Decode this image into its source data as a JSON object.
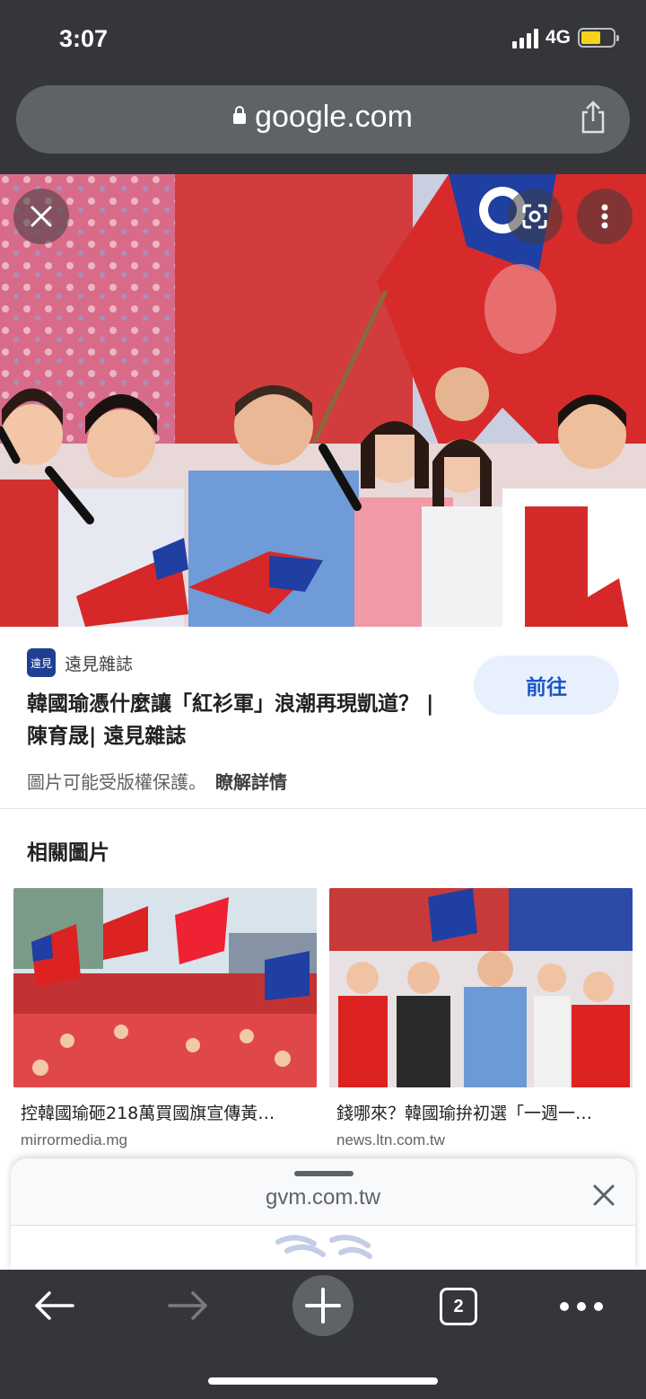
{
  "status_bar": {
    "time": "3:07",
    "network": "4G",
    "battery_level": 0.62
  },
  "browser": {
    "url": "google.com"
  },
  "result": {
    "source_name": "遠見雜誌",
    "source_logo_text": "遠見",
    "title": "韓國瑜憑什麼讓「紅衫軍」浪潮再現凱道？ | 陳育晟| 遠見雜誌",
    "visit_label": "前往",
    "copyright_notice": "圖片可能受版權保護。",
    "learn_more": "瞭解詳情"
  },
  "related": {
    "heading": "相關圖片",
    "items": [
      {
        "title": "控韓國瑜砸218萬買國旗宣傳黃…",
        "domain": "mirrormedia.mg"
      },
      {
        "title": "錢哪來？韓國瑜拚初選「一週一…",
        "domain": "news.ltn.com.tw"
      }
    ]
  },
  "sheet": {
    "url": "gvm.com.tw"
  },
  "toolbar": {
    "tab_count": "2"
  },
  "icons": {
    "close": "close-icon",
    "lens": "lens-icon",
    "more": "more-vert-icon",
    "share": "share-icon",
    "back": "back-arrow-icon",
    "forward": "forward-arrow-icon",
    "new_tab": "plus-icon",
    "tabs": "tab-switcher-icon",
    "menu": "more-horiz-icon"
  },
  "colors": {
    "chrome": "#35363a",
    "url_bar": "#5f6368",
    "accent": "#1a56c8",
    "visit_bg": "#e8f0fe",
    "battery": "#f6d21a"
  }
}
